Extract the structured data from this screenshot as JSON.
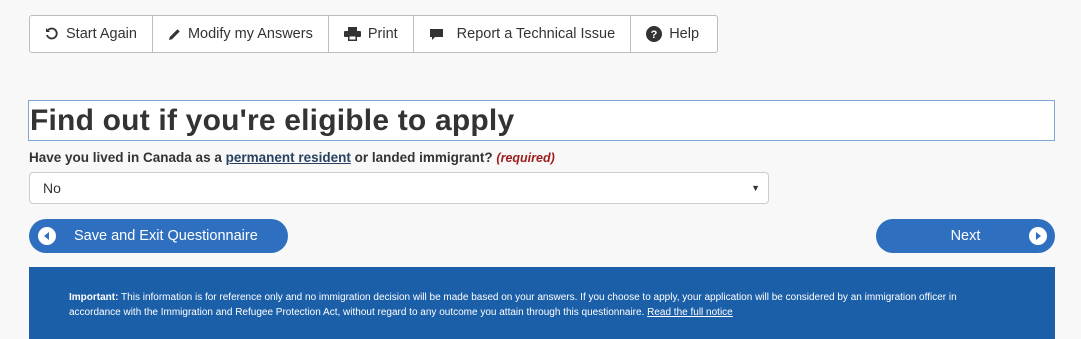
{
  "toolbar": {
    "start_again": "Start Again",
    "modify_answers": "Modify my Answers",
    "print": "Print",
    "report_issue": "Report a Technical Issue",
    "help": "Help"
  },
  "page": {
    "title": "Find out if you're eligible to apply"
  },
  "question": {
    "prefix": "Have you lived in Canada as a ",
    "link": "permanent resident",
    "suffix": " or landed immigrant?",
    "required": "(required)"
  },
  "answer_select": {
    "selected": "No"
  },
  "buttons": {
    "save_exit": "Save and Exit Questionnaire",
    "next": "Next"
  },
  "notice": {
    "label": "Important:",
    "text": " This information is for reference only and no immigration decision will be made based on your answers. If you choose to apply, your application will be considered by an immigration officer in accordance with the Immigration and Refugee Protection Act, without regard to any outcome you attain through this questionnaire. ",
    "link": "Read the full notice"
  },
  "colors": {
    "primary_button": "#2e6fc0",
    "notice_background": "#1b5fa8",
    "required_text": "#9c1c1c"
  },
  "icons": [
    "refresh-icon",
    "pencil-icon",
    "printer-icon",
    "comment-icon",
    "question-circle-icon",
    "arrow-left-circle-icon",
    "arrow-right-circle-icon"
  ]
}
